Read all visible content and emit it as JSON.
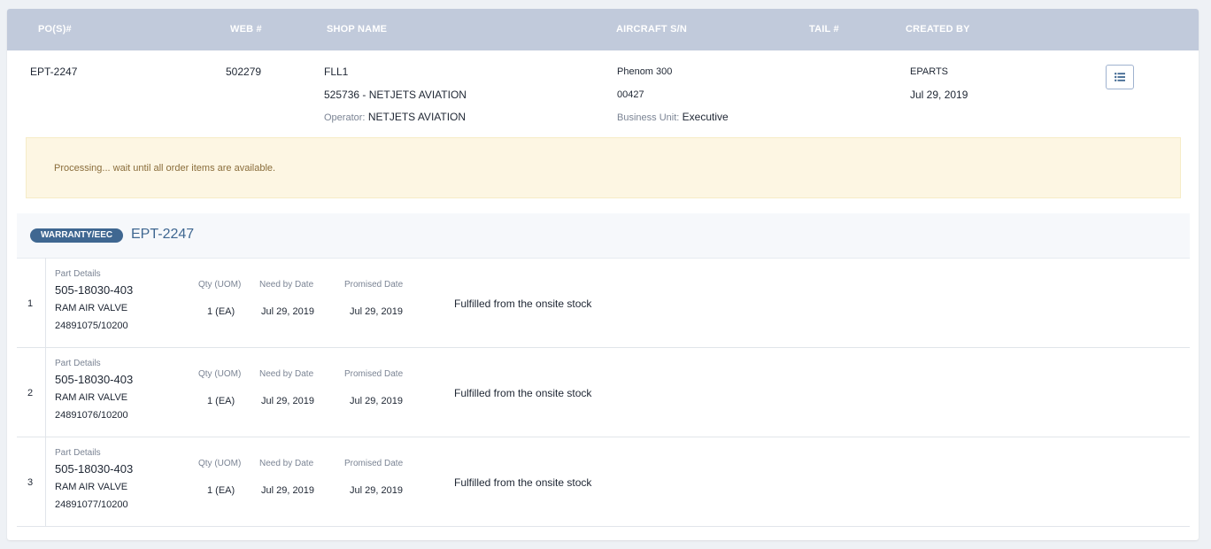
{
  "colors": {
    "header_bar": "#c1cadb",
    "badge": "#3f6791",
    "alert_bg": "#fdf6e3",
    "alert_text": "#8a6d3b"
  },
  "header": {
    "po": "PO(S)#",
    "web": "WEB #",
    "shop": "SHOP NAME",
    "aircraft": "AIRCRAFT S/N",
    "tail": "TAIL #",
    "created_by": "CREATED BY"
  },
  "summary": {
    "po": "EPT-2247",
    "web": "502279",
    "shop_code": "FLL1",
    "shop_name": "525736 - NETJETS AVIATION",
    "operator_label": "Operator:",
    "operator_value": "NETJETS AVIATION",
    "aircraft_model": "Phenom 300",
    "aircraft_sn": "00427",
    "business_unit_label": "Business Unit:",
    "business_unit_value": "Executive",
    "created_by": "EPARTS",
    "created_date": "Jul 29, 2019",
    "list_button_icon": "list-icon"
  },
  "alert": {
    "message": "Processing... wait until all order items are available."
  },
  "order": {
    "badge": "WARRANTY/EEC",
    "number": "EPT-2247"
  },
  "items": [
    {
      "index": "1",
      "part_label": "Part Details",
      "part_number": "505-18030-403",
      "description": "RAM AIR VALVE",
      "serial": "24891075/10200",
      "qty_label": "Qty (UOM)",
      "qty": "1 (EA)",
      "need_label": "Need by Date",
      "need_date": "Jul 29, 2019",
      "promised_label": "Promised Date",
      "promised_date": "Jul 29, 2019",
      "status": "Fulfilled from the onsite stock"
    },
    {
      "index": "2",
      "part_label": "Part Details",
      "part_number": "505-18030-403",
      "description": "RAM AIR VALVE",
      "serial": "24891076/10200",
      "qty_label": "Qty (UOM)",
      "qty": "1 (EA)",
      "need_label": "Need by Date",
      "need_date": "Jul 29, 2019",
      "promised_label": "Promised Date",
      "promised_date": "Jul 29, 2019",
      "status": "Fulfilled from the onsite stock"
    },
    {
      "index": "3",
      "part_label": "Part Details",
      "part_number": "505-18030-403",
      "description": "RAM AIR VALVE",
      "serial": "24891077/10200",
      "qty_label": "Qty (UOM)",
      "qty": "1 (EA)",
      "need_label": "Need by Date",
      "need_date": "Jul 29, 2019",
      "promised_label": "Promised Date",
      "promised_date": "Jul 29, 2019",
      "status": "Fulfilled from the onsite stock"
    }
  ]
}
